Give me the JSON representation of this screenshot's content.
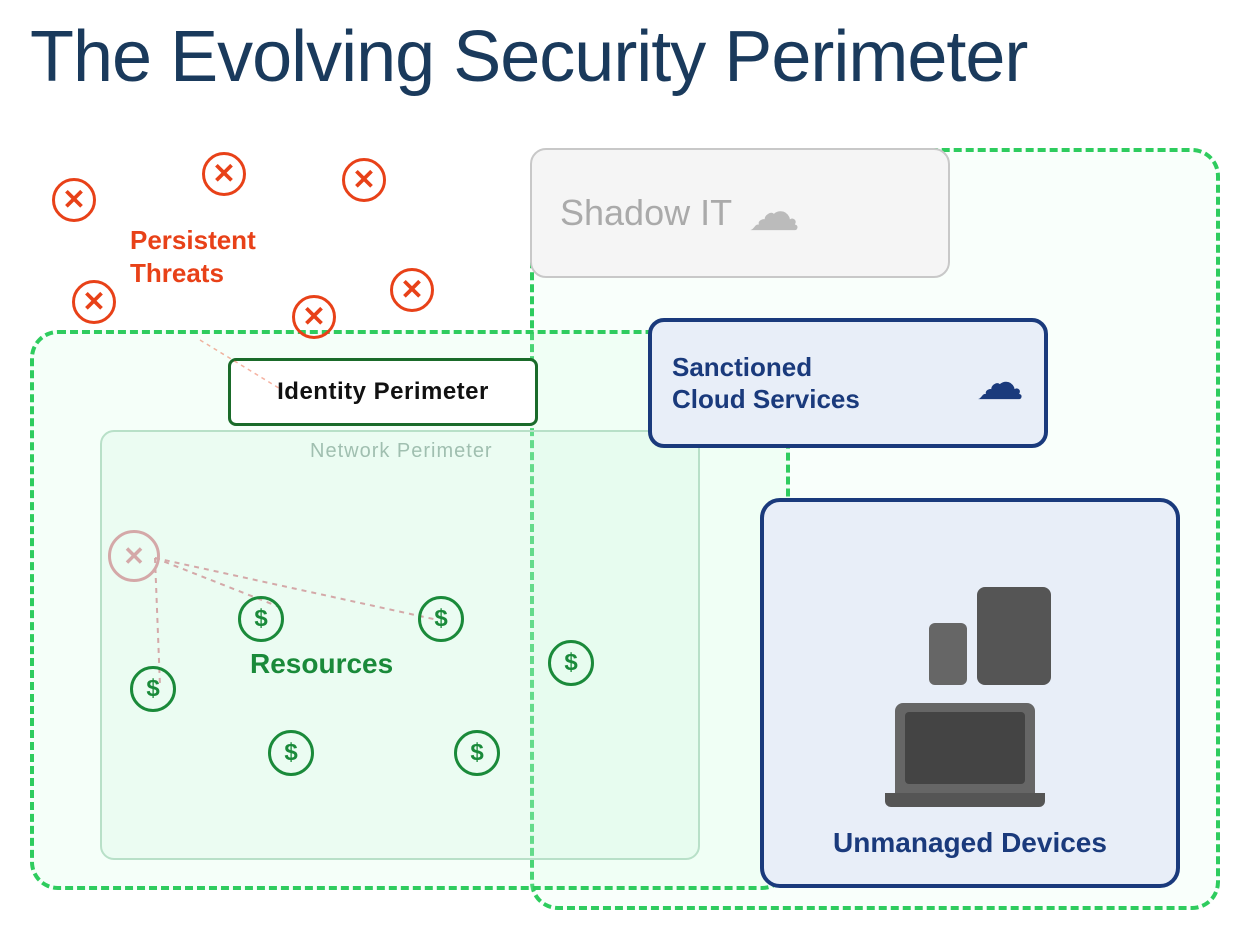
{
  "page": {
    "title": "The Evolving Security Perimeter",
    "background": "#ffffff"
  },
  "labels": {
    "main_title": "The Evolving Security Perimeter",
    "identity_perimeter": "Identity Perimeter",
    "network_perimeter": "Network Perimeter",
    "persistent_threats": "Persistent\nThreats",
    "resources": "Resources",
    "shadow_it": "Shadow IT",
    "sanctioned_cloud": "Sanctioned\nCloud Services",
    "unmanaged_devices": "Unmanaged\nDevices"
  },
  "colors": {
    "title": "#1a3a5c",
    "threat_red": "#e84118",
    "perimeter_green": "#2ecc5e",
    "dark_green": "#1a6b2a",
    "resource_green": "#1a8a3a",
    "navy_blue": "#1a3a7c",
    "gray_text": "#aaa",
    "faded_threat": "#d4a8a8"
  },
  "icons": {
    "cloud_gray": "☁",
    "cloud_blue": "☁",
    "x_mark": "✕",
    "dollar": "$"
  }
}
